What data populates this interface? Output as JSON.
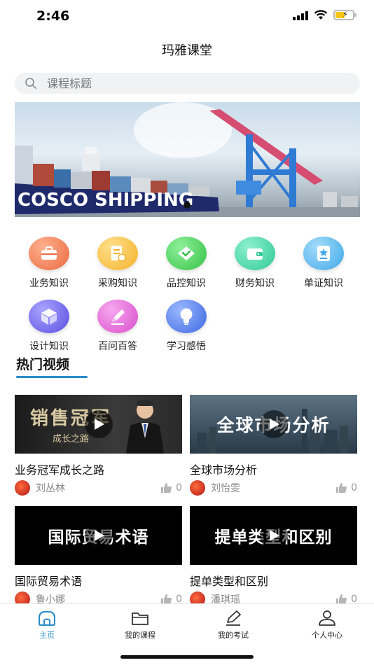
{
  "status_bar": {
    "time": "2:46"
  },
  "nav": {
    "title": "玛雅课堂"
  },
  "search": {
    "placeholder": "课程标题"
  },
  "banner": {
    "ship_text": "COSCO SHIPPING"
  },
  "categories": [
    {
      "label": "业务知识",
      "icon": "briefcase-icon",
      "color": "#f07a52"
    },
    {
      "label": "采购知识",
      "icon": "receipt-icon",
      "color": "#f6be3d"
    },
    {
      "label": "品控知识",
      "icon": "diamond-check-icon",
      "color": "#4fcf5c"
    },
    {
      "label": "财务知识",
      "icon": "wallet-icon",
      "color": "#43d4a6"
    },
    {
      "label": "单证知识",
      "icon": "document-star-icon",
      "color": "#58b8ec"
    },
    {
      "label": "设计知识",
      "icon": "cube-icon",
      "color": "#6b63e8"
    },
    {
      "label": "百问百答",
      "icon": "pencil-icon",
      "color": "#e46ad8"
    },
    {
      "label": "学习感悟",
      "icon": "lightbulb-icon",
      "color": "#4b78e6"
    }
  ],
  "hot_videos": {
    "title": "热门视频",
    "items": [
      {
        "title": "业务冠军成长之路",
        "thumb_text": "销售冠军",
        "thumb_sub": "成长之路",
        "author": "刘丛林",
        "likes": "0"
      },
      {
        "title": "全球市场分析",
        "thumb_text": "全球市场分析",
        "thumb_sub": "",
        "author": "刘怡雯",
        "likes": "0"
      },
      {
        "title": "国际贸易术语",
        "thumb_text": "国际贸易术语",
        "thumb_sub": "",
        "author": "鲁小娜",
        "likes": "0"
      },
      {
        "title": "提单类型和区别",
        "thumb_text": "提单类型和区别",
        "thumb_sub": "",
        "author": "潘琪瑶",
        "likes": "0"
      }
    ]
  },
  "tab_bar": {
    "tabs": [
      {
        "label": "主页",
        "icon": "home-icon",
        "active": true
      },
      {
        "label": "我的课程",
        "icon": "folder-icon",
        "active": false
      },
      {
        "label": "我的考试",
        "icon": "pen-icon",
        "active": false
      },
      {
        "label": "个人中心",
        "icon": "person-icon",
        "active": false
      }
    ]
  },
  "colors": {
    "accent": "#2a8cc8"
  }
}
